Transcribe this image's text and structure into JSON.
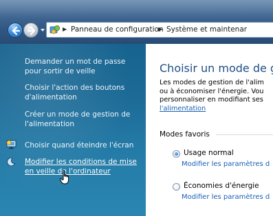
{
  "address_bar": {
    "crumbs": [
      "Panneau de configuration",
      "Système et maintenar"
    ]
  },
  "sidebar": {
    "tasks": [
      "Demander un mot de passe",
      "pour sortir de veille",
      "Choisir l'action des boutons",
      "d'alimentation",
      "Créer un mode de gestion de",
      "l'alimentation",
      "Choisir quand éteindre l'écran",
      "Modifier les conditions de mise",
      "en veille de l'ordinateur"
    ]
  },
  "main": {
    "title": "Choisir un mode de ges",
    "intro": [
      "Les modes de gestion de l'alim",
      "ou à économiser l'énergie. Vou",
      "personnaliser en modifiant ses"
    ],
    "intro_link": "l'alimentation",
    "favorites_label": "Modes favoris",
    "plans": [
      {
        "name": "Usage normal",
        "link": "Modifier les paramètres d",
        "selected": true
      },
      {
        "name": "Économies d'énergie",
        "link": "Modifier les paramètres d",
        "selected": false
      }
    ]
  },
  "colors": {
    "sidebar_bg": "#1c6a96",
    "title_blue": "#1e4f87",
    "link_blue": "#1a5fb4"
  },
  "icons": [
    "back-arrow-icon",
    "forward-arrow-icon",
    "control-panel-icon",
    "monitor-icon",
    "moon-icon",
    "hand-cursor-icon"
  ]
}
